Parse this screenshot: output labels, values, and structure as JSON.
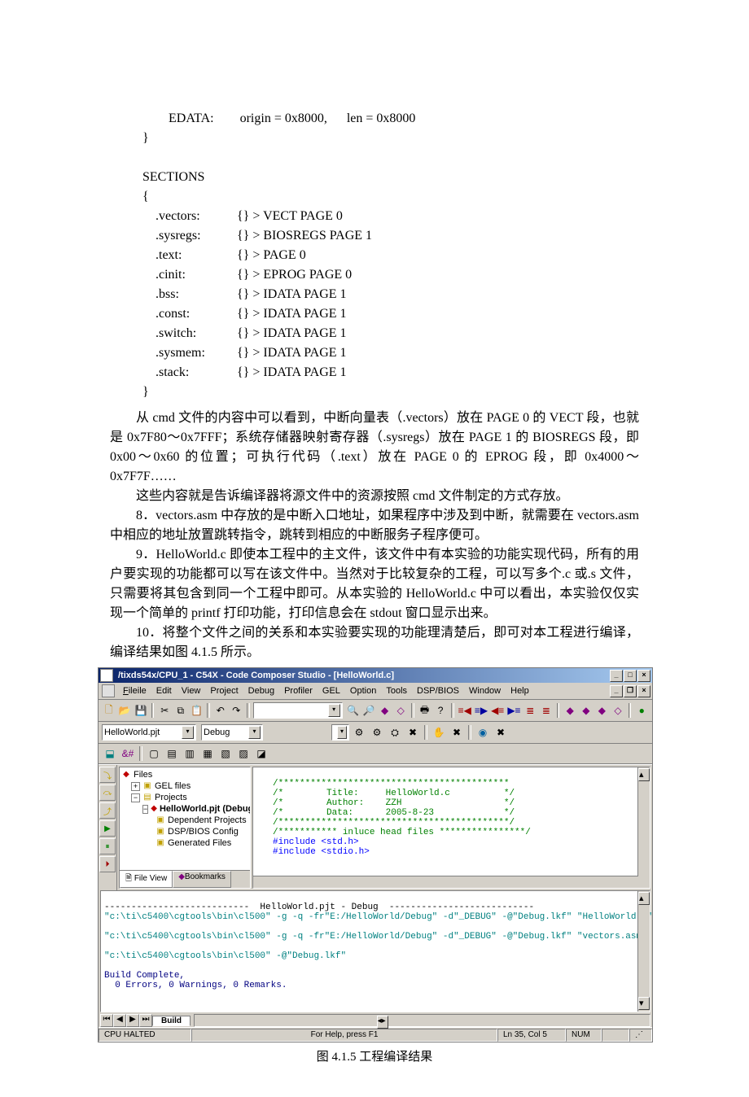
{
  "code": {
    "edata": "        EDATA:        origin = 0x8000,      len = 0x8000",
    "close1": "}",
    "sections_header": "SECTIONS",
    "open2": "{",
    "rows": [
      {
        "l": ".vectors:",
        "r": "{} > VECT PAGE 0"
      },
      {
        "l": ".sysregs:",
        "r": "{} > BIOSREGS PAGE 1"
      },
      {
        "l": ".text:",
        "r": "{} > PAGE 0"
      },
      {
        "l": ".cinit:",
        "r": "{} > EPROG PAGE 0"
      },
      {
        "l": ".bss:",
        "r": "{} > IDATA PAGE 1"
      },
      {
        "l": ".const:",
        "r": "{} > IDATA PAGE 1"
      },
      {
        "l": ".switch:",
        "r": "{} > IDATA PAGE 1"
      },
      {
        "l": ".sysmem:",
        "r": "{} > IDATA PAGE 1"
      },
      {
        "l": ".stack:",
        "r": "{} > IDATA PAGE 1"
      }
    ],
    "close2": "}"
  },
  "paragraphs": {
    "p1": "从 cmd 文件的内容中可以看到，中断向量表（.vectors）放在 PAGE 0 的 VECT 段，也就是 0x7F80～0x7FFF；系统存储器映射寄存器（.sysregs）放在 PAGE 1 的 BIOSREGS 段，即 0x00～0x60 的位置；可执行代码（.text）放在 PAGE 0 的 EPROG 段，即 0x4000～0x7F7F……",
    "p2": "这些内容就是告诉编译器将源文件中的资源按照 cmd 文件制定的方式存放。",
    "p3": "8．vectors.asm 中存放的是中断入口地址，如果程序中涉及到中断，就需要在 vectors.asm 中相应的地址放置跳转指令，跳转到相应的中断服务子程序便可。",
    "p4": "9．HelloWorld.c 即使本工程中的主文件，该文件中有本实验的功能实现代码，所有的用户要实现的功能都可以写在该文件中。当然对于比较复杂的工程，可以写多个.c 或.s 文件，只需要将其包含到同一个工程中即可。从本实验的 HelloWorld.c 中可以看出，本实验仅仅实现一个简单的 printf 打印功能，打印信息会在 stdout 窗口显示出来。",
    "p5": "10．将整个文件之间的关系和本实验要实现的功能理清楚后，即可对本工程进行编译，编译结果如图 4.1.5 所示。"
  },
  "ide": {
    "title": "/tixds54x/CPU_1 - C54X - Code Composer Studio - [HelloWorld.c]",
    "menu": [
      "File",
      "Edit",
      "View",
      "Project",
      "Debug",
      "Profiler",
      "GEL",
      "Option",
      "Tools",
      "DSP/BIOS",
      "Window",
      "Help"
    ],
    "combo1": "HelloWorld.pjt",
    "combo2": "Debug",
    "tree": {
      "root": "Files",
      "n1": "GEL files",
      "n2": "Projects",
      "n3": "HelloWorld.pjt (Debug)",
      "n4": "Dependent Projects",
      "n5": "DSP/BIOS Config",
      "n6": "Generated Files",
      "tabs": {
        "a": "File View",
        "b": "Bookmarks"
      }
    },
    "editor": {
      "l1": "/*******************************************",
      "l2": "/*        Title:     HelloWorld.c          */",
      "l3": "/*        Author:    ZZH                   */",
      "l4": "/*        Data:      2005-8-23             */",
      "l5": "/*******************************************/",
      "l6": "/*********** inluce head files ****************/",
      "l7": "#include <std.h>",
      "l8": "#include <stdio.h>"
    },
    "build": {
      "sep": "---------------------------  HelloWorld.pjt - Debug  ---------------------------",
      "l1": "\"c:\\ti\\c5400\\cgtools\\bin\\cl500\" -g -q -fr\"E:/HelloWorld/Debug\" -d\"_DEBUG\" -@\"Debug.lkf\" \"HelloWorld.c\"",
      "l2": "\"c:\\ti\\c5400\\cgtools\\bin\\cl500\" -g -q -fr\"E:/HelloWorld/Debug\" -d\"_DEBUG\" -@\"Debug.lkf\" \"vectors.asm\"",
      "l3": "\"c:\\ti\\c5400\\cgtools\\bin\\cl500\" -@\"Debug.lkf\"",
      "complete": "Build Complete,",
      "result": "  0 Errors, 0 Warnings, 0 Remarks.",
      "tab": "Build"
    },
    "status": {
      "halted": "CPU HALTED",
      "help": "For Help, press F1",
      "pos": "Ln 35, Col 5",
      "num": "NUM"
    }
  },
  "caption": "图 4.1.5   工程编译结果"
}
